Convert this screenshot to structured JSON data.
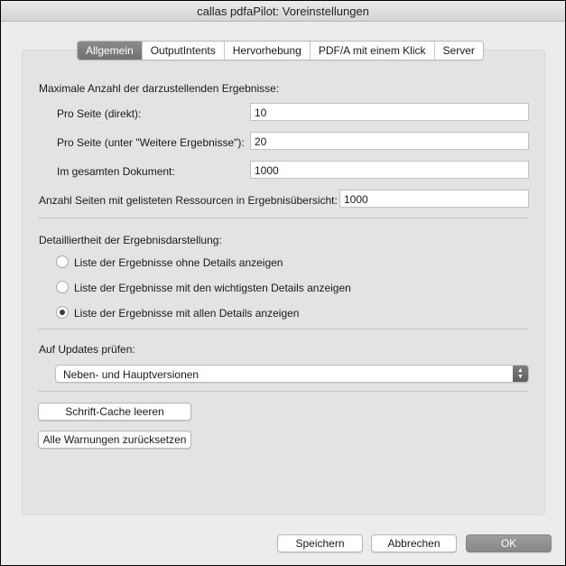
{
  "window": {
    "title": "callas pdfaPilot: Voreinstellungen"
  },
  "tabs": [
    {
      "label": "Allgemein",
      "active": true
    },
    {
      "label": "OutputIntents",
      "active": false
    },
    {
      "label": "Hervorhebung",
      "active": false
    },
    {
      "label": "PDF/A mit einem Klick",
      "active": false
    },
    {
      "label": "Server",
      "active": false
    }
  ],
  "results": {
    "heading": "Maximale Anzahl der darzustellenden Ergebnisse:",
    "per_page_direct_label": "Pro Seite (direkt):",
    "per_page_direct_value": "10",
    "per_page_more_label": "Pro Seite (unter \"Weitere Ergebnisse\"):",
    "per_page_more_value": "20",
    "whole_document_label": "Im gesamten Dokument:",
    "whole_document_value": "1000",
    "resources_pages_label": "Anzahl Seiten mit gelisteten Ressourcen in Ergebnisübersicht:",
    "resources_pages_value": "1000"
  },
  "detail": {
    "heading": "Detailliertheit der Ergebnisdarstellung:",
    "options": [
      {
        "label": "Liste der Ergebnisse ohne Details anzeigen",
        "selected": false
      },
      {
        "label": "Liste der Ergebnisse mit den wichtigsten Details anzeigen",
        "selected": false
      },
      {
        "label": "Liste der Ergebnisse mit allen Details anzeigen",
        "selected": true
      }
    ]
  },
  "updates": {
    "heading": "Auf Updates prüfen:",
    "selected": "Neben- und Hauptversionen"
  },
  "buttons": {
    "clear_font_cache": "Schrift-Cache leeren",
    "reset_warnings": "Alle Warnungen zurücksetzen",
    "save": "Speichern",
    "cancel": "Abbrechen",
    "ok": "OK"
  }
}
